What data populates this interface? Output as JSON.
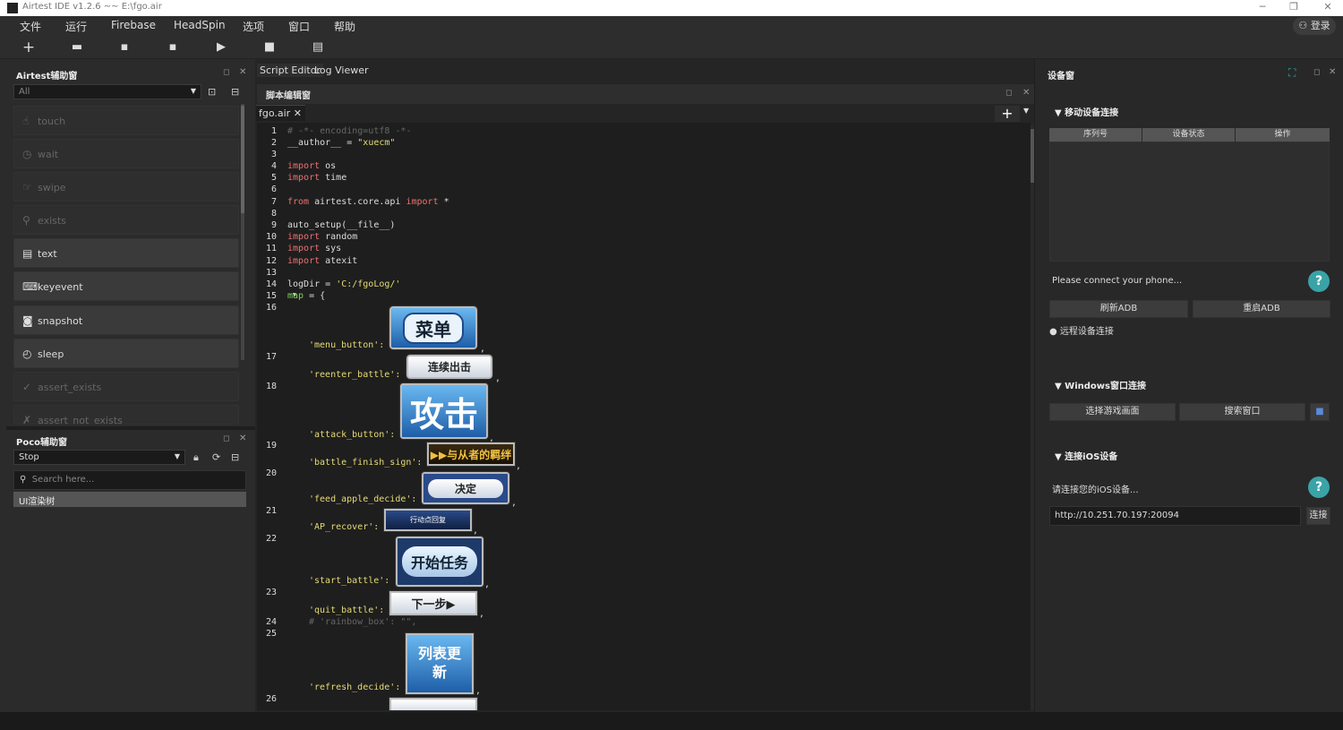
{
  "window": {
    "title": "Airtest IDE v1.2.6 ~~ E:\\fgo.air",
    "controls": [
      "─",
      "❐",
      "✕"
    ]
  },
  "menu": {
    "items": [
      "文件",
      "运行",
      "Firebase",
      "HeadSpin",
      "选项",
      "窗口",
      "帮助"
    ],
    "login": "登录"
  },
  "toolbar": {
    "icons": [
      "new-icon",
      "open-folder-icon",
      "save-icon",
      "save-as-icon",
      "run-icon",
      "stop-icon",
      "log-icon"
    ]
  },
  "airtest_panel": {
    "title": "Airtest辅助窗",
    "filter": "All",
    "buttons": [
      {
        "label": "touch",
        "icon": "☝",
        "enabled": false
      },
      {
        "label": "wait",
        "icon": "◷",
        "enabled": false
      },
      {
        "label": "swipe",
        "icon": "☞",
        "enabled": false
      },
      {
        "label": "exists",
        "icon": "⚲",
        "enabled": false
      },
      {
        "label": "text",
        "icon": "▤",
        "enabled": true
      },
      {
        "label": "keyevent",
        "icon": "⌨",
        "enabled": true
      },
      {
        "label": "snapshot",
        "icon": "◙",
        "enabled": true
      },
      {
        "label": "sleep",
        "icon": "◴",
        "enabled": true
      },
      {
        "label": "assert_exists",
        "icon": "✓",
        "enabled": false
      },
      {
        "label": "assert_not_exists",
        "icon": "✗",
        "enabled": false
      }
    ]
  },
  "poco_panel": {
    "title": "Poco辅助窗",
    "mode": "Stop",
    "search_placeholder": "Search here...",
    "tree_label": "UI渲染树"
  },
  "editor": {
    "tabs": [
      "Script Editor",
      "Log Viewer"
    ],
    "pane_title": "脚本编辑窗",
    "file_tab": "fgo.air",
    "line_numbers": [
      "1",
      "2",
      "3",
      "4",
      "5",
      "6",
      "7",
      "8",
      "9",
      "10",
      "11",
      "12",
      "13",
      "14",
      "15",
      "16",
      "17",
      "18",
      "19",
      "20",
      "21",
      "22",
      "23",
      "24",
      "25",
      "26"
    ],
    "code": {
      "l1": "# -*- encoding=utf8 -*-",
      "l2a": "__author__ = ",
      "l2b": "\"xuecm\"",
      "kw_import": "import",
      "kw_from": "from",
      "l4b": " os",
      "l5b": " time",
      "l7b": " airtest.core.api ",
      "l7d": " *",
      "l9": "auto_setup(__file__)",
      "l10b": " random",
      "l11b": " sys",
      "l12b": " atexit",
      "l14a": "logDir = ",
      "l14b": "'C:/fgoLog/'",
      "l15a": "map",
      "l15b": " = {",
      "l24": "# 'rainbow_box': \"\",",
      "keys": [
        "'menu_button':",
        "'reenter_battle':",
        "'attack_button':",
        "'battle_finish_sign':",
        "'feed_apple_decide':",
        "'AP_recover':",
        "'start_battle':",
        "'quit_battle':",
        "'refresh_decide':"
      ],
      "comma": ","
    },
    "images": [
      "菜单",
      "连续出击",
      "攻击",
      "▶▶与从者的羁绊",
      "决定",
      "行动点回复",
      "开始任务",
      "下一步▶",
      "列表更新"
    ]
  },
  "device_panel": {
    "title": "设备窗",
    "mobile_section": "▼ 移动设备连接",
    "table_headers": [
      "序列号",
      "设备状态",
      "操作"
    ],
    "status": "Please connect your phone...",
    "refresh_adb": "刷新ADB",
    "restart_adb": "重启ADB",
    "remote_connect": "远程设备连接",
    "windows_section": "▼ Windows窗口连接",
    "select_game": "选择游戏画面",
    "search_window": "搜索窗口",
    "ios_section": "▼ 连接iOS设备",
    "ios_prompt": "请连接您的iOS设备...",
    "ios_url": "http://10.251.70.197:20094",
    "connect": "连接",
    "help": "?"
  }
}
